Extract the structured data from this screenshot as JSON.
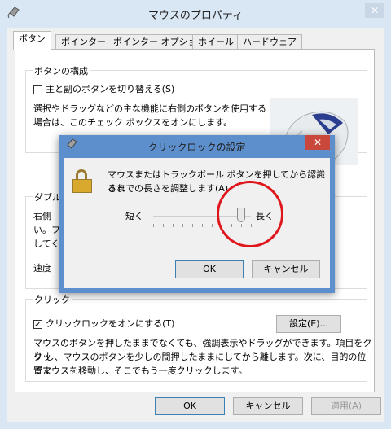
{
  "window": {
    "title": "マウスのプロパティ",
    "close_glyph": "✕"
  },
  "tabs": [
    {
      "label": "ボタン"
    },
    {
      "label": "ポインター"
    },
    {
      "label": "ポインター オプション"
    },
    {
      "label": "ホイール"
    },
    {
      "label": "ハードウェア"
    }
  ],
  "button_config": {
    "group_title": "ボタンの構成",
    "swap_label": "主と副のボタンを切り替える(S)",
    "swap_checked": false,
    "desc_line1": "選択やドラッグなどの主な機能に右側のボタンを使用する",
    "desc_line2": "場合は、このチェック ボックスをオンにします。"
  },
  "double_click": {
    "group_title_partial": "ダブル",
    "line1_partial": "右側",
    "line2_partial": "い。フ",
    "line3_partial": "してく",
    "speed_partial": "速度"
  },
  "clicklock": {
    "group_title_partial": "クリック",
    "checkbox_label": "クリックロックをオンにする(T)",
    "checked": true,
    "settings_button": "設定(E)...",
    "desc_line1": "マウスのボタンを押したままでなくても、強調表示やドラッグができます。項目をクリッ",
    "desc_line2": "ク し、マウスのボタンを少しの間押したままにしてから離します。次に、目的の位置ま",
    "desc_line3": "でマウスを移動し、そこでもう一度クリックします。"
  },
  "footer": {
    "ok": "OK",
    "cancel": "キャンセル",
    "apply": "適用(A)"
  },
  "dialog": {
    "title": "クリックロックの設定",
    "close_glyph": "✕",
    "message_line1": "マウスまたはトラックボール ボタンを押してから認識され",
    "message_line2": "るまでの長さを調整します(A)",
    "slider_min_label": "短く",
    "slider_max_label": "長く",
    "slider_value_fraction": 0.9,
    "ok": "OK",
    "cancel": "キャンセル"
  },
  "colors": {
    "dialog_frame": "#5c8fcb",
    "close_red": "#c9483b",
    "annotation_circle": "#e0161d"
  }
}
